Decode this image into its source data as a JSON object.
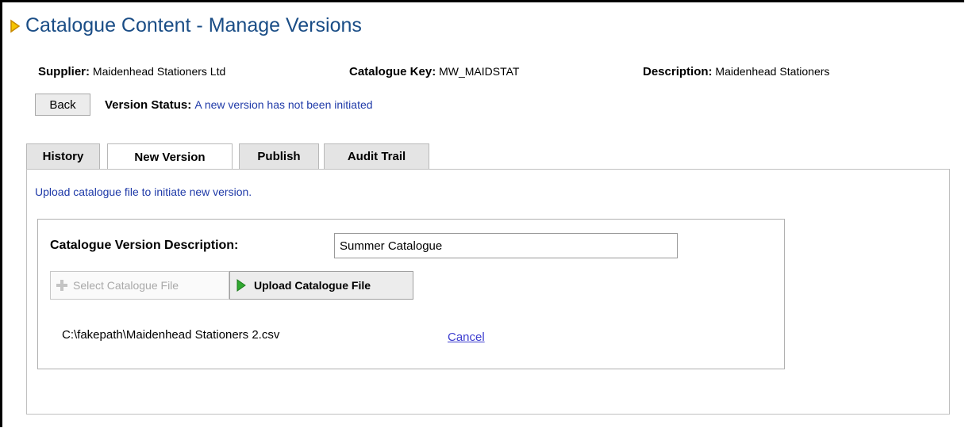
{
  "page": {
    "title": "Catalogue Content - Manage Versions",
    "accent_color": "#1a4d86",
    "marker_icon": "play-triangle-icon",
    "marker_color": "#e8a000"
  },
  "meta": {
    "supplier_label": "Supplier:",
    "supplier_value": "Maidenhead Stationers Ltd",
    "catalogue_key_label": "Catalogue Key:",
    "catalogue_key_value": "MW_MAIDSTAT",
    "description_label": "Description:",
    "description_value": "Maidenhead Stationers"
  },
  "toolbar": {
    "back_label": "Back",
    "version_status_label": "Version Status:",
    "version_status_value": "A new version has not been initiated"
  },
  "tabs": [
    {
      "label": "History",
      "active": false
    },
    {
      "label": "New Version",
      "active": true
    },
    {
      "label": "Publish",
      "active": false
    },
    {
      "label": "Audit Trail",
      "active": false
    }
  ],
  "panel": {
    "instruction": "Upload catalogue file to initiate new version.",
    "description_label": "Catalogue Version Description:",
    "description_value": "Summer Catalogue",
    "select_file_label": "Select Catalogue File",
    "select_file_icon": "plus-icon",
    "upload_label": "Upload Catalogue File",
    "upload_icon": "green-arrow-icon",
    "file_path": "C:\\fakepath\\Maidenhead Stationers 2.csv",
    "cancel_label": "Cancel"
  }
}
